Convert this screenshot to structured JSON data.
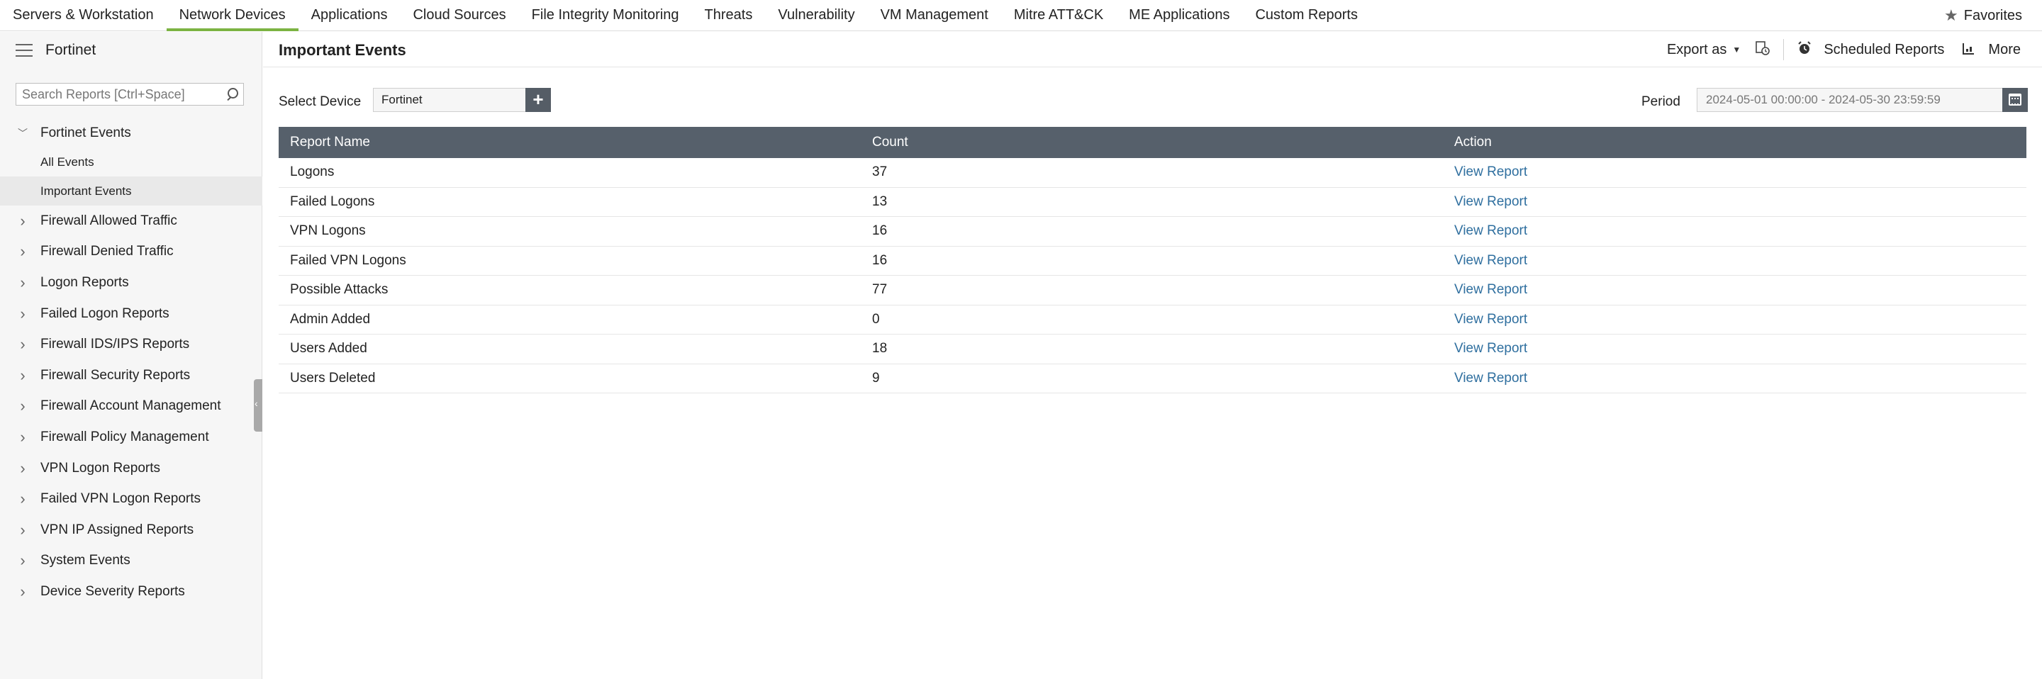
{
  "topnav": {
    "tabs": [
      {
        "label": "Servers & Workstation"
      },
      {
        "label": "Network Devices"
      },
      {
        "label": "Applications"
      },
      {
        "label": "Cloud Sources"
      },
      {
        "label": "File Integrity Monitoring"
      },
      {
        "label": "Threats"
      },
      {
        "label": "Vulnerability"
      },
      {
        "label": "VM Management"
      },
      {
        "label": "Mitre ATT&CK"
      },
      {
        "label": "ME Applications"
      },
      {
        "label": "Custom Reports"
      }
    ],
    "active_tab": "Network Devices",
    "favorites_label": "Favorites"
  },
  "sidebar": {
    "title": "Fortinet",
    "search_placeholder": "Search Reports [Ctrl+Space]",
    "expanded_group": {
      "label": "Fortinet Events",
      "children": [
        {
          "label": "All Events"
        },
        {
          "label": "Important Events",
          "selected": true
        }
      ]
    },
    "groups": [
      {
        "label": "Firewall Allowed Traffic"
      },
      {
        "label": "Firewall Denied Traffic"
      },
      {
        "label": "Logon Reports"
      },
      {
        "label": "Failed Logon Reports"
      },
      {
        "label": "Firewall IDS/IPS Reports"
      },
      {
        "label": "Firewall Security Reports"
      },
      {
        "label": "Firewall Account Management"
      },
      {
        "label": "Firewall Policy Management"
      },
      {
        "label": "VPN Logon Reports"
      },
      {
        "label": "Failed VPN Logon Reports"
      },
      {
        "label": "VPN IP Assigned Reports"
      },
      {
        "label": "System Events"
      },
      {
        "label": "Device Severity Reports"
      }
    ]
  },
  "main": {
    "title": "Important Events",
    "actions": {
      "export_label": "Export as",
      "scheduled_label": "Scheduled Reports",
      "more_label": "More"
    },
    "filters": {
      "device_label": "Select Device",
      "device_value": "Fortinet",
      "period_label": "Period",
      "period_value": "2024-05-01 00:00:00 - 2024-05-30 23:59:59"
    },
    "table": {
      "headers": {
        "name": "Report Name",
        "count": "Count",
        "action": "Action"
      },
      "rows": [
        {
          "name": "Logons",
          "count": "37",
          "action": "View Report"
        },
        {
          "name": "Failed Logons",
          "count": "13",
          "action": "View Report"
        },
        {
          "name": "VPN Logons",
          "count": "16",
          "action": "View Report"
        },
        {
          "name": "Failed VPN Logons",
          "count": "16",
          "action": "View Report"
        },
        {
          "name": "Possible Attacks",
          "count": "77",
          "action": "View Report"
        },
        {
          "name": "Admin Added",
          "count": "0",
          "action": "View Report"
        },
        {
          "name": "Users Added",
          "count": "18",
          "action": "View Report"
        },
        {
          "name": "Users Deleted",
          "count": "9",
          "action": "View Report"
        }
      ]
    }
  },
  "colors": {
    "active_tab_underline": "#7cb342",
    "table_header_bg": "#56606b",
    "link": "#2f6f9f"
  },
  "icons": [
    "hamburger-icon",
    "search-icon",
    "chevron-down-icon",
    "chevron-right-icon",
    "star-icon",
    "export-caret-icon",
    "schedule-export-icon",
    "alarm-clock-icon",
    "more-icon",
    "plus-icon",
    "calendar-icon"
  ]
}
